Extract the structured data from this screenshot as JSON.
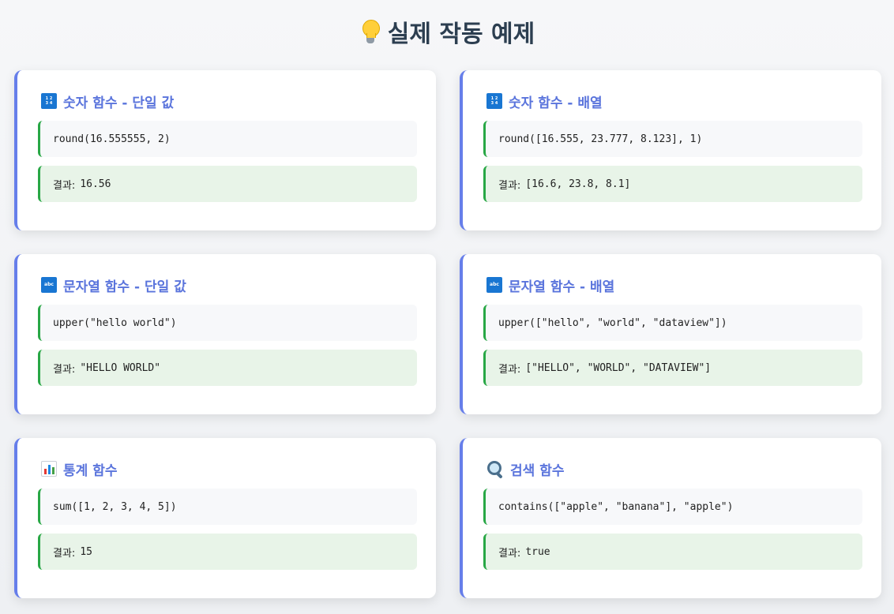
{
  "page": {
    "title": "실제 작동 예제",
    "title_icon": "lightbulb-icon"
  },
  "result_label": "결과:",
  "cards": [
    {
      "icon": "numbers-icon",
      "title": "숫자 함수 - 단일 값",
      "code": "round(16.555555, 2)",
      "result": "16.56"
    },
    {
      "icon": "numbers-icon",
      "title": "숫자 함수 - 배열",
      "code": "round([16.555, 23.777, 8.123], 1)",
      "result": "[16.6, 23.8, 8.1]"
    },
    {
      "icon": "abc-icon",
      "title": "문자열 함수 - 단일 값",
      "code": "upper(\"hello world\")",
      "result": "\"HELLO WORLD\""
    },
    {
      "icon": "abc-icon",
      "title": "문자열 함수 - 배열",
      "code": "upper([\"hello\", \"world\", \"dataview\"])",
      "result": "[\"HELLO\", \"WORLD\", \"DATAVIEW\"]"
    },
    {
      "icon": "bar-chart-icon",
      "title": "통계 함수",
      "code": "sum([1, 2, 3, 4, 5])",
      "result": "15"
    },
    {
      "icon": "search-icon",
      "title": "검색 함수",
      "code": "contains([\"apple\", \"banana\"], \"apple\")",
      "result": "true"
    }
  ],
  "colors": {
    "accent": "#667eea",
    "code_border": "#28a745",
    "result_bg": "#e8f4e8"
  }
}
